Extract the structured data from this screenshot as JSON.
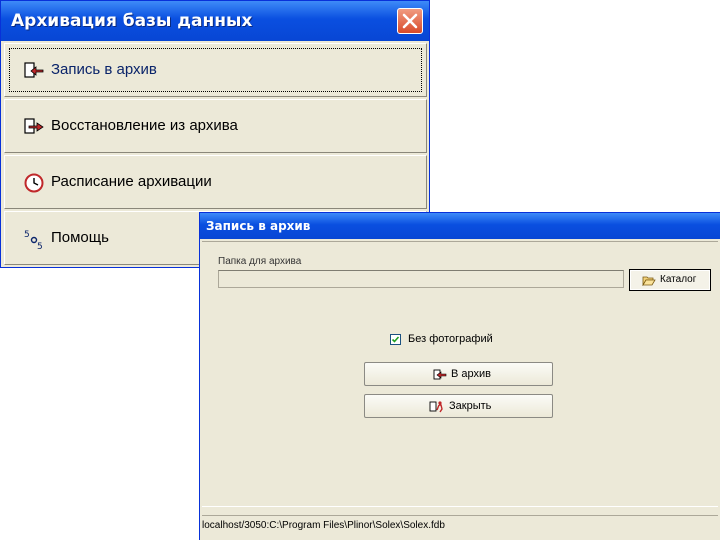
{
  "main": {
    "title": "Архивация базы данных",
    "items": [
      {
        "label": "Запись в архив",
        "icon": "archive-write-icon"
      },
      {
        "label": "Восстановление из архива",
        "icon": "archive-restore-icon"
      },
      {
        "label": "Расписание архивации",
        "icon": "clock-icon"
      },
      {
        "label": "Помощь",
        "icon": "help-icon"
      }
    ]
  },
  "dialog": {
    "title": "Запись в архив",
    "folder_label": "Папка для архива",
    "folder_value": "",
    "catalog_button": "Каталог",
    "checkbox_label": "Без фотографий",
    "checkbox_checked": true,
    "archive_button": "В архив",
    "close_button": "Закрыть",
    "status": "localhost/3050:C:\\Program Files\\Plinor\\Solex\\Solex.fdb"
  },
  "colors": {
    "titlebar": "#0A4FE0",
    "window_bg": "#ECE9D8",
    "accent_red": "#C0282A"
  }
}
